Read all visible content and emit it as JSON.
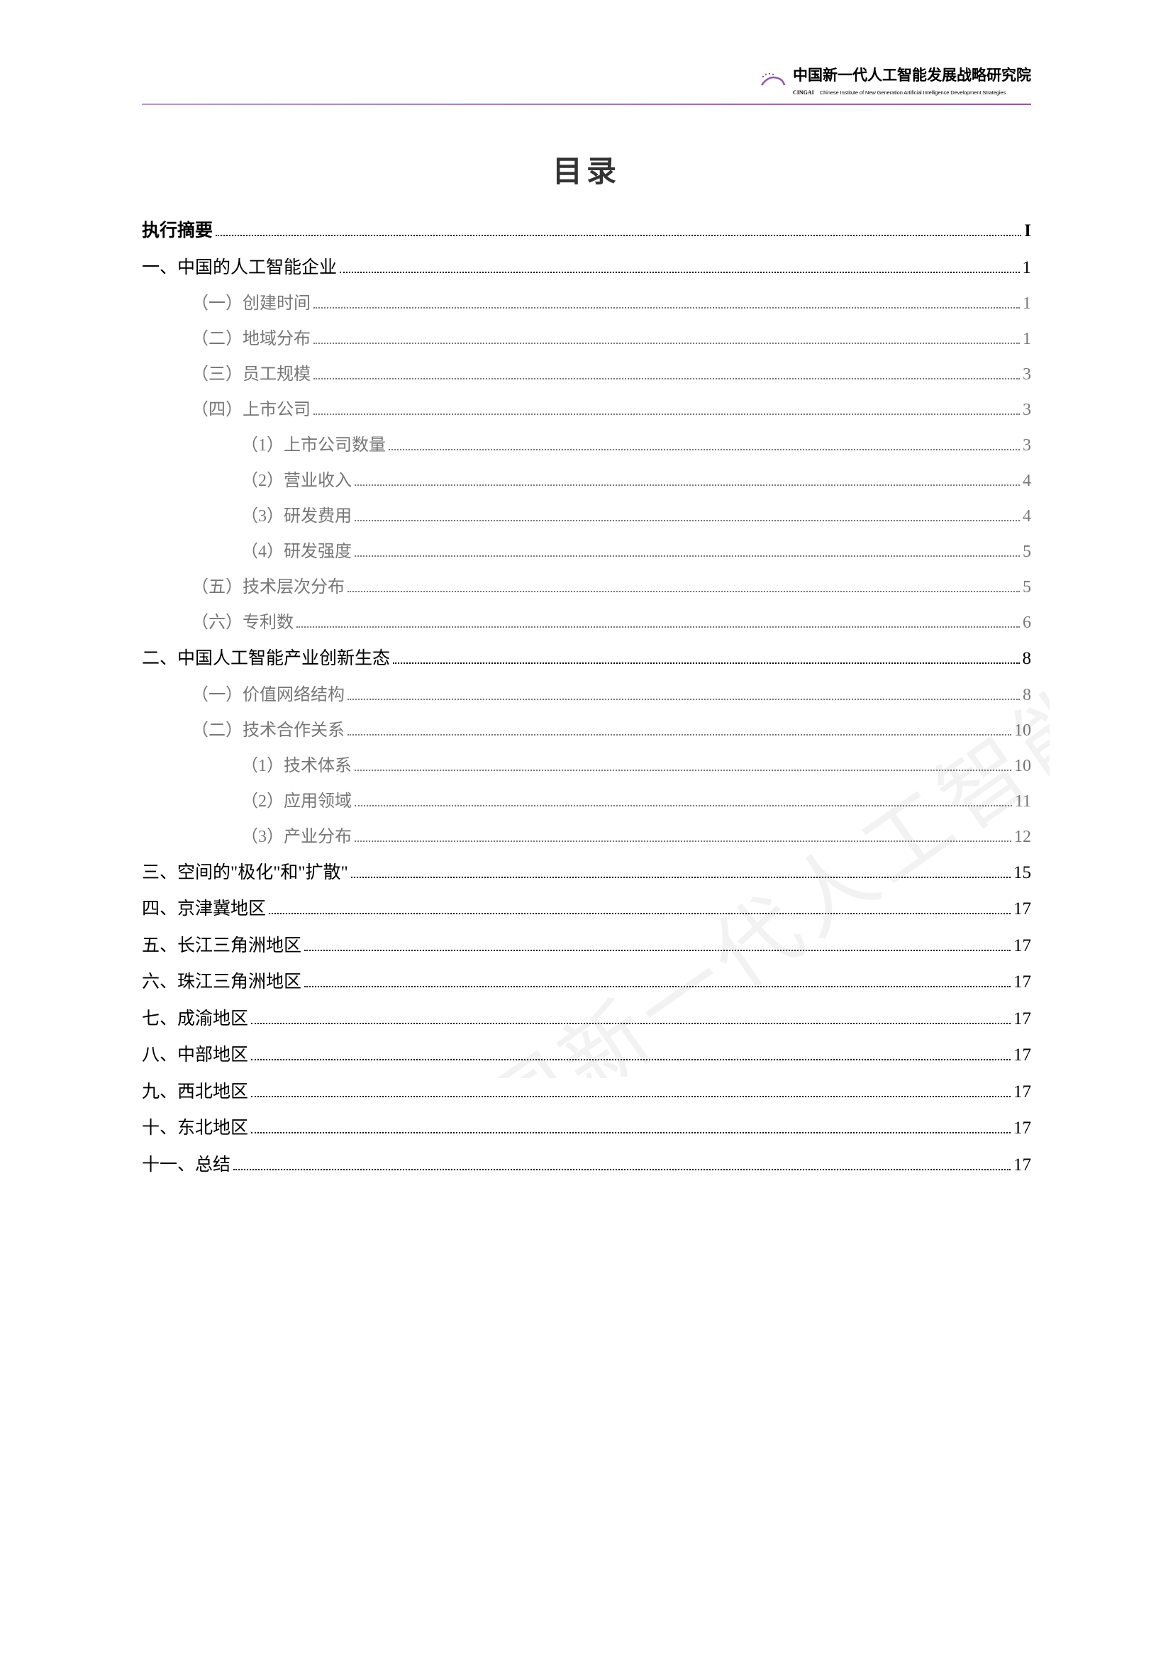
{
  "header": {
    "org_name_cn": "中国新一代人工智能发展战略研究院",
    "org_abbr": "CINGAI",
    "org_name_en": "Chinese Institute of New Generation Artificial Intelligence Development Strategies"
  },
  "title": "目录",
  "watermark": "中国新一代人工智能发展战略研究院",
  "toc": [
    {
      "level": 1,
      "bold": true,
      "label": "执行摘要",
      "page": "I"
    },
    {
      "level": 1,
      "bold": false,
      "label": "一、中国的人工智能企业",
      "page": "1"
    },
    {
      "level": 2,
      "label": "（一）创建时间",
      "page": "1"
    },
    {
      "level": 2,
      "label": "（二）地域分布",
      "page": "1"
    },
    {
      "level": 2,
      "label": "（三）员工规模",
      "page": "3"
    },
    {
      "level": 2,
      "label": "（四）上市公司",
      "page": "3"
    },
    {
      "level": 3,
      "label": "（1）上市公司数量",
      "page": "3"
    },
    {
      "level": 3,
      "label": "（2）营业收入",
      "page": "4"
    },
    {
      "level": 3,
      "label": "（3）研发费用",
      "page": "4"
    },
    {
      "level": 3,
      "label": "（4）研发强度",
      "page": "5"
    },
    {
      "level": 2,
      "label": "（五）技术层次分布",
      "page": "5"
    },
    {
      "level": 2,
      "label": "（六）专利数",
      "page": "6"
    },
    {
      "level": 1,
      "bold": false,
      "label": "二、中国人工智能产业创新生态",
      "page": "8"
    },
    {
      "level": 2,
      "label": "（一）价值网络结构",
      "page": "8"
    },
    {
      "level": 2,
      "label": "（二）技术合作关系",
      "page": "10"
    },
    {
      "level": 3,
      "label": "（1）技术体系",
      "page": "10"
    },
    {
      "level": 3,
      "label": "（2）应用领域",
      "page": "11"
    },
    {
      "level": 3,
      "label": "（3）产业分布",
      "page": "12"
    },
    {
      "level": 1,
      "bold": false,
      "label": "三、空间的\"极化\"和\"扩散\"",
      "page": "15"
    },
    {
      "level": 1,
      "bold": false,
      "label": "四、京津冀地区",
      "page": "17"
    },
    {
      "level": 1,
      "bold": false,
      "label": "五、长江三角洲地区",
      "page": "17"
    },
    {
      "level": 1,
      "bold": false,
      "label": "六、珠江三角洲地区",
      "page": "17"
    },
    {
      "level": 1,
      "bold": false,
      "label": "七、成渝地区",
      "page": "17"
    },
    {
      "level": 1,
      "bold": false,
      "label": "八、中部地区",
      "page": "17"
    },
    {
      "level": 1,
      "bold": false,
      "label": "九、西北地区",
      "page": "17"
    },
    {
      "level": 1,
      "bold": false,
      "label": "十、东北地区",
      "page": "17"
    },
    {
      "level": 1,
      "bold": false,
      "label": "十一、总结",
      "page": "17"
    }
  ]
}
